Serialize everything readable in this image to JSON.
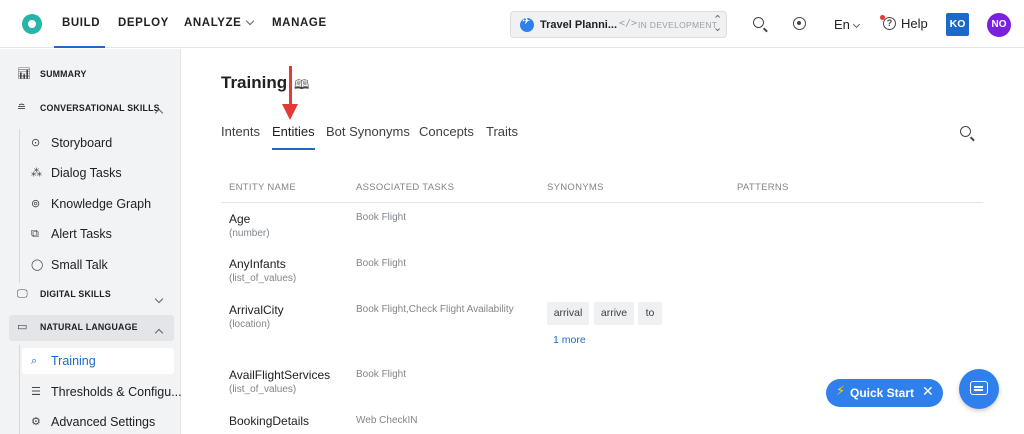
{
  "topnav": {
    "items": [
      "BUILD",
      "DEPLOY",
      "ANALYZE",
      "MANAGE"
    ],
    "active": "BUILD"
  },
  "app_switcher": {
    "name": "Travel Planni...",
    "code_glyph": "</>",
    "status": "IN DEVELOPMENT"
  },
  "header_right": {
    "language": "En",
    "help": "Help",
    "user_initials": "KO",
    "account_initials": "NO"
  },
  "sidebar": {
    "summary": "SUMMARY",
    "conversational": "CONVERSATIONAL SKILLS",
    "conv_items": [
      "Storyboard",
      "Dialog Tasks",
      "Knowledge Graph",
      "Alert Tasks",
      "Small Talk"
    ],
    "digital": "DIGITAL SKILLS",
    "natural": "NATURAL LANGUAGE",
    "nl_items": [
      "Training",
      "Thresholds & Configu...",
      "Advanced Settings"
    ]
  },
  "page": {
    "title": "Training",
    "tabs": [
      "Intents",
      "Entities",
      "Bot Synonyms",
      "Concepts",
      "Traits"
    ],
    "active_tab": "Entities"
  },
  "table": {
    "headers": [
      "ENTITY NAME",
      "ASSOCIATED TASKS",
      "SYNONYMS",
      "PATTERNS"
    ],
    "rows": [
      {
        "name": "Age",
        "type": "(number)",
        "tasks": "Book Flight"
      },
      {
        "name": "AnyInfants",
        "type": "(list_of_values)",
        "tasks": "Book Flight"
      },
      {
        "name": "ArrivalCity",
        "type": "(location)",
        "tasks": "Book Flight,Check Flight Availability",
        "synonyms": [
          "arrival",
          "arrive",
          "to"
        ],
        "more": "1 more"
      },
      {
        "name": "AvailFlightServices",
        "type": "(list_of_values)",
        "tasks": "Book Flight"
      },
      {
        "name": "BookingDetails",
        "type": "",
        "tasks": "Web CheckIN"
      }
    ]
  },
  "quick_start": {
    "label": "Quick Start"
  },
  "colors": {
    "accent": "#1b6ac9",
    "annotation_arrow": "#e53935",
    "quick_start": "#2f80ed"
  }
}
